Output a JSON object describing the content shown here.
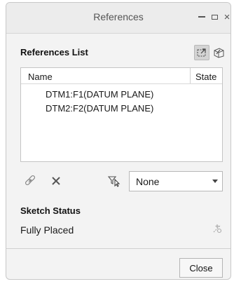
{
  "window": {
    "title": "References",
    "controls": [
      "minimize-icon",
      "maximize-icon",
      "close-icon"
    ],
    "close_glyph": "×"
  },
  "references": {
    "section_title": "References List",
    "view_icons": [
      "pick-references-icon",
      "select-geometry-icon"
    ],
    "columns": {
      "name": "Name",
      "state": "State"
    },
    "rows": [
      {
        "name": "DTM1:F1(DATUM PLANE)",
        "state": ""
      },
      {
        "name": "DTM2:F2(DATUM PLANE)",
        "state": ""
      }
    ]
  },
  "toolbar": {
    "icons": [
      "link-icon",
      "delete-x-icon",
      "filter-icon"
    ],
    "filter_value": "None"
  },
  "sketch_status": {
    "section_title": "Sketch Status",
    "status": "Fully Placed",
    "icon": "solve-sketch-icon"
  },
  "footer": {
    "close_label": "Close"
  },
  "colors": {
    "window_bg": "#f3f3f3",
    "titlebar_bg": "#ececec",
    "list_bg": "#ffffff",
    "delete_x": "#555555"
  }
}
